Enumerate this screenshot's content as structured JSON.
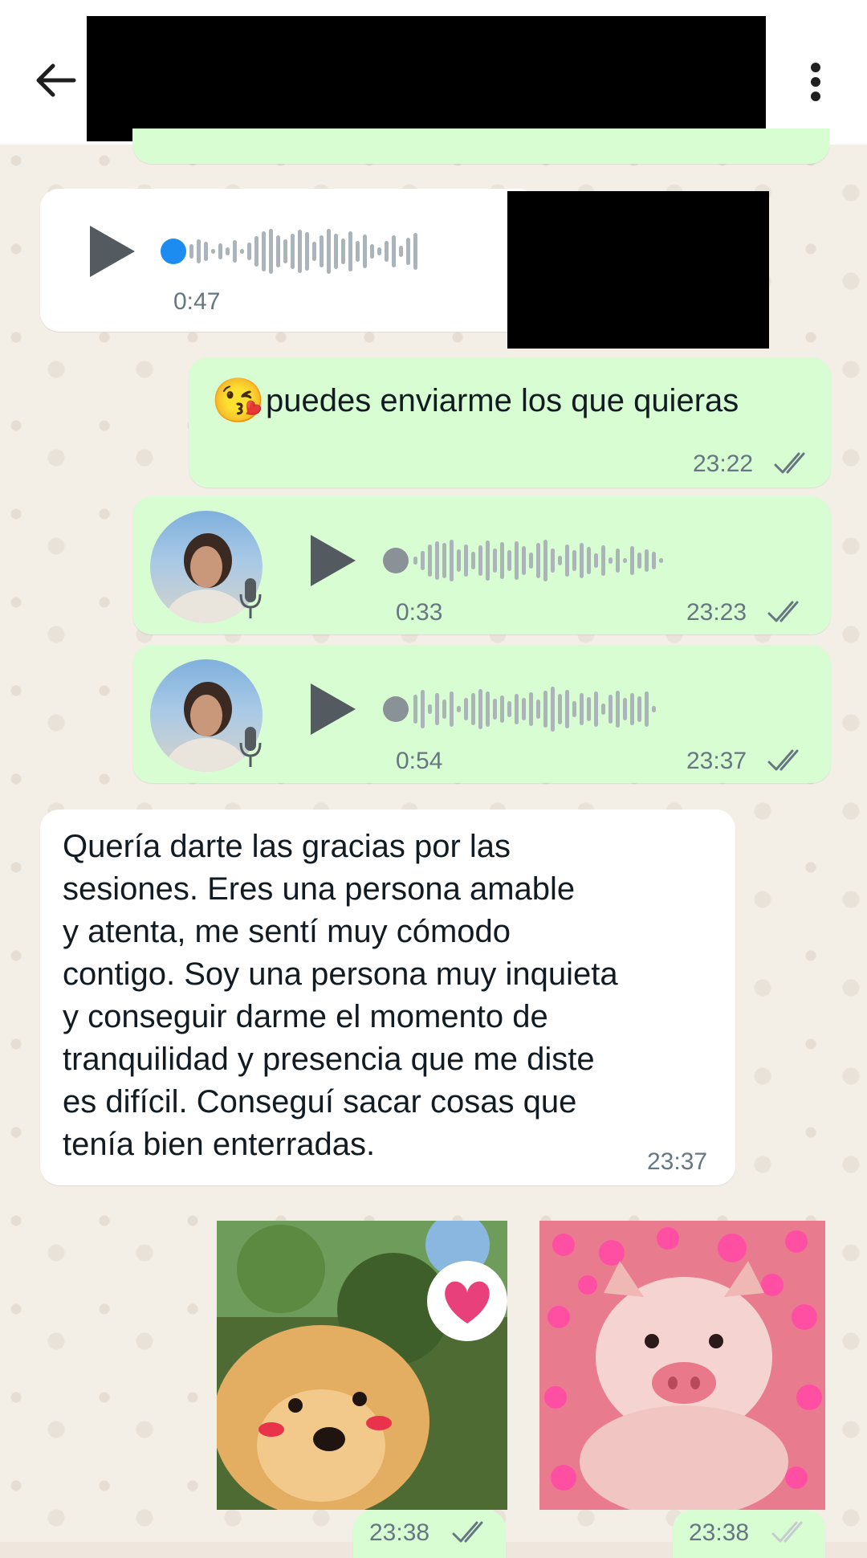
{
  "messages": [
    {
      "type": "voice",
      "duration": "0:47"
    },
    {
      "type": "text",
      "text": "puedes enviarme los que quieras",
      "emoji": "😘",
      "time": "23:22"
    },
    {
      "type": "voice",
      "duration": "0:33",
      "time": "23:23"
    },
    {
      "type": "voice",
      "duration": "0:54",
      "time": "23:37"
    },
    {
      "type": "text",
      "lines": [
        "Quería darte las gracias por las",
        "sesiones. Eres una persona amable",
        "y atenta, me sentí muy cómodo",
        "contigo. Soy una persona muy inquieta",
        "y conseguir darme el momento de",
        "tranquilidad y presencia que me diste",
        "es difícil. Conseguí sacar cosas que",
        "tenía bien enterradas."
      ],
      "time": "23:37"
    },
    {
      "type": "sticker",
      "subject": "puppy-with-heart",
      "time": "23:38"
    },
    {
      "type": "sticker",
      "subject": "piglet-with-hearts",
      "time": "23:38"
    }
  ],
  "colors": {
    "outgoing_bubble": "#d9fdd3",
    "incoming_bubble": "#ffffff",
    "read_ticks": "#667781",
    "voice_unplayed_dot": "#1c8cf0"
  }
}
